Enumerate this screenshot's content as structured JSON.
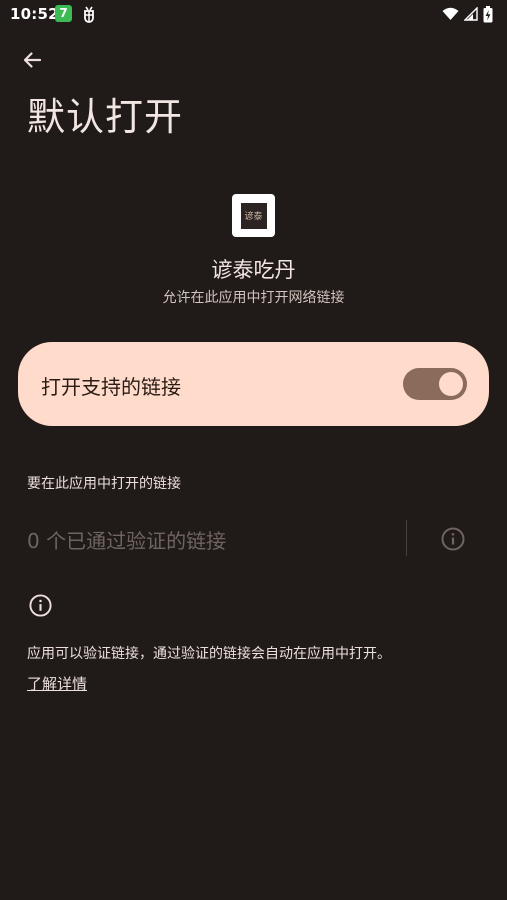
{
  "status_bar": {
    "time": "10:52",
    "notif_green_label": "7",
    "icons": [
      "wifi-icon",
      "signal-icon",
      "battery-icon"
    ]
  },
  "header": {
    "title": "默认打开"
  },
  "app": {
    "name": "谚泰吃丹",
    "subtitle": "允许在此应用中打开网络链接",
    "icon_text": "谚泰"
  },
  "toggle": {
    "label": "打开支持的链接",
    "enabled": true
  },
  "links_section": {
    "header": "要在此应用中打开的链接",
    "verified_text": "0 个已通过验证的链接"
  },
  "footer": {
    "description": "应用可以验证链接，通过验证的链接会自动在应用中打开。",
    "learn_more": "了解详情"
  },
  "colors": {
    "background": "#201a18",
    "card": "#ffdbcb",
    "switch_track": "#8a6b5c"
  }
}
